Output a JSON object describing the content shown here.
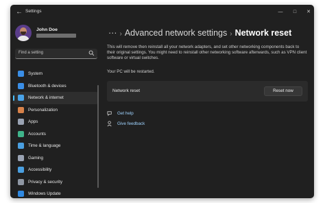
{
  "window": {
    "title": "Settings"
  },
  "user": {
    "name": "John Doe"
  },
  "search": {
    "placeholder": "Find a setting"
  },
  "nav": [
    {
      "label": "System",
      "icon": "system-icon",
      "color": "#3a8ee6"
    },
    {
      "label": "Bluetooth & devices",
      "icon": "bluetooth-icon",
      "color": "#3a8ee6"
    },
    {
      "label": "Network & internet",
      "icon": "wifi-icon",
      "color": "#4aa3e8",
      "selected": true
    },
    {
      "label": "Personalization",
      "icon": "brush-icon",
      "color": "#d8824a"
    },
    {
      "label": "Apps",
      "icon": "apps-icon",
      "color": "#9aa3b3"
    },
    {
      "label": "Accounts",
      "icon": "person-icon",
      "color": "#3fb48a"
    },
    {
      "label": "Time & language",
      "icon": "globe-clock-icon",
      "color": "#4a9fe0"
    },
    {
      "label": "Gaming",
      "icon": "controller-icon",
      "color": "#9aa3b3"
    },
    {
      "label": "Accessibility",
      "icon": "accessibility-icon",
      "color": "#4a9fe0"
    },
    {
      "label": "Privacy & security",
      "icon": "shield-icon",
      "color": "#8f97a3"
    },
    {
      "label": "Windows Update",
      "icon": "update-icon",
      "color": "#2f88e0"
    }
  ],
  "breadcrumb": {
    "more": "···",
    "parent": "Advanced network settings",
    "current": "Network reset"
  },
  "main": {
    "description": "This will remove then reinstall all your network adapters, and set other networking components back to their original settings. You might need to reinstall other networking software afterwards, such as VPN client software or virtual switches.",
    "restart_note": "Your PC will be restarted.",
    "reset_card": {
      "label": "Network reset",
      "button": "Reset now"
    },
    "links": {
      "help": "Get help",
      "feedback": "Give feedback"
    }
  },
  "colors": {
    "accent": "#4cc2ff",
    "window_bg": "#202020",
    "card_bg": "#2b2b2b",
    "link": "#9fd3ff"
  }
}
